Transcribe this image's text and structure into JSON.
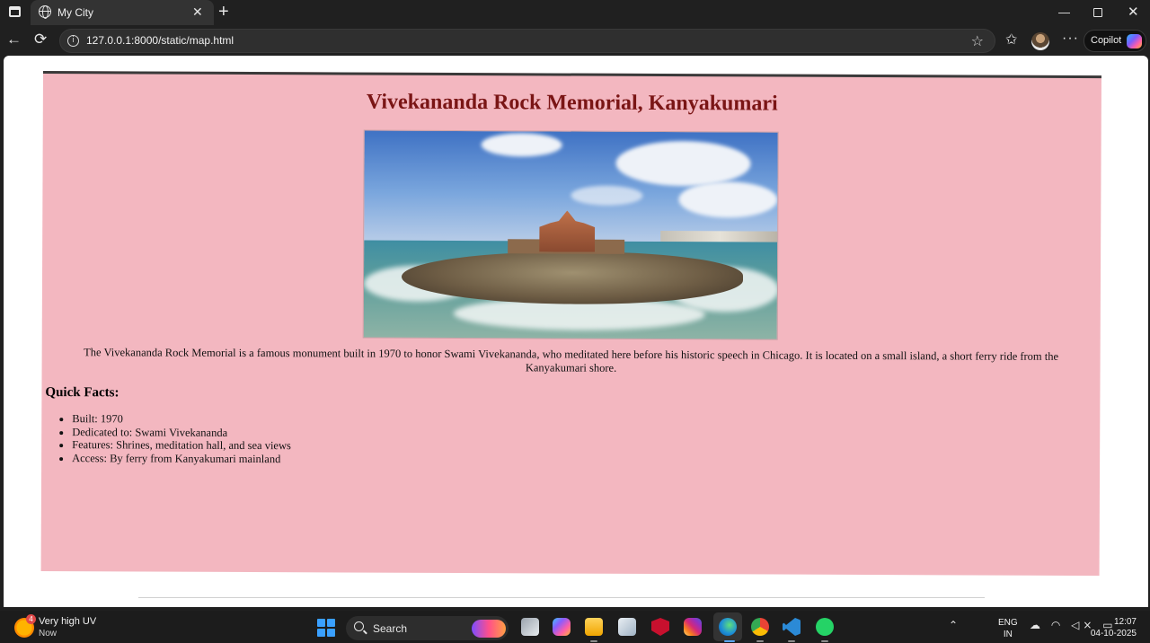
{
  "browser": {
    "tab": {
      "title": "My City"
    },
    "address_bar": {
      "url": "127.0.0.1:8000/static/map.html"
    },
    "copilot_label": "Copilot",
    "icons": {
      "window_menu": "window-icon",
      "tab_favicon": "globe-icon",
      "tab_close": "close-icon",
      "new_tab": "plus-icon",
      "back": "back-arrow-icon",
      "reload": "reload-icon",
      "site_info": "info-icon",
      "favorite": "star-icon",
      "favorites_list": "favorites-icon",
      "more": "more-icon"
    },
    "glyphs": {
      "close": "✕",
      "plus": "+",
      "minimize": "—",
      "back": "←",
      "reload": "⟳",
      "info": "i",
      "star": "☆",
      "favorites": "✩",
      "more": "···"
    }
  },
  "page": {
    "title": "Vivekananda Rock Memorial, Kanyakumari",
    "description": "The Vivekananda Rock Memorial is a famous monument built in 1970 to honor Swami Vivekananda, who meditated here before his historic speech in Chicago. It is located on a small island, a short ferry ride from the Kanyakumari shore.",
    "facts_heading": "Quick Facts:",
    "facts": [
      "Built: 1970",
      "Dedicated to: Swami Vivekananda",
      "Features: Shrines, meditation hall, and sea views",
      "Access: By ferry from Kanyakumari mainland"
    ],
    "background_color": "#f3b7c0",
    "title_color": "#7a1515"
  },
  "taskbar": {
    "weather": {
      "badge": "4",
      "text": "Very high UV",
      "sub": "Now"
    },
    "search_label": "Search",
    "language": {
      "line1": "ENG",
      "line2": "IN"
    },
    "clock": {
      "time": "12:07",
      "date": "04-10-2025"
    },
    "tray_chevron": "⌃",
    "tray_icons": "☁ ◠ ◁× ▭"
  }
}
